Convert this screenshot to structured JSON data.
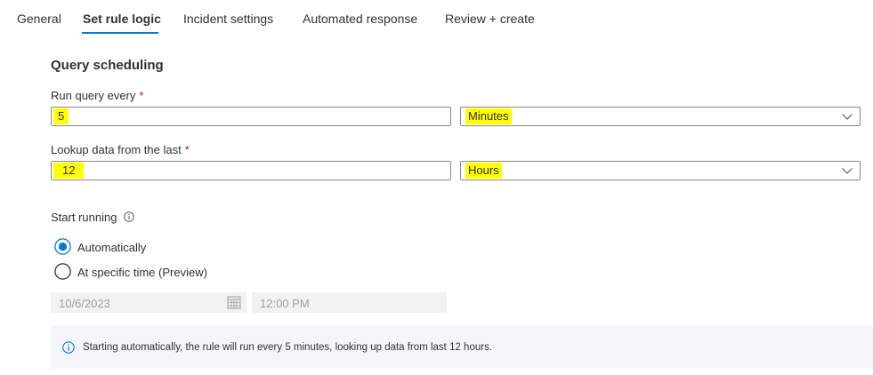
{
  "tabs": [
    {
      "label": "General"
    },
    {
      "label": "Set rule logic"
    },
    {
      "label": "Incident settings"
    },
    {
      "label": "Automated response"
    },
    {
      "label": "Review + create"
    }
  ],
  "active_tab": "Set rule logic",
  "section": {
    "title": "Query scheduling"
  },
  "run_query": {
    "label": "Run query every",
    "required_mark": "*",
    "value": "5",
    "unit": "Minutes"
  },
  "lookup": {
    "label": "Lookup data from the last",
    "required_mark": "*",
    "value": "12",
    "unit": "Hours"
  },
  "start_running": {
    "label": "Start running",
    "options": [
      {
        "label": "Automatically",
        "selected": true
      },
      {
        "label": "At specific time (Preview)",
        "selected": false
      }
    ],
    "date": "10/6/2023",
    "time": "12:00 PM"
  },
  "info": {
    "message": "Starting automatically, the rule will run every 5 minutes, looking up data from last 12 hours."
  },
  "colors": {
    "accent": "#0078d4",
    "highlight": "#ffff00",
    "required": "#a4262c",
    "info_bg": "#f4f6fb"
  }
}
